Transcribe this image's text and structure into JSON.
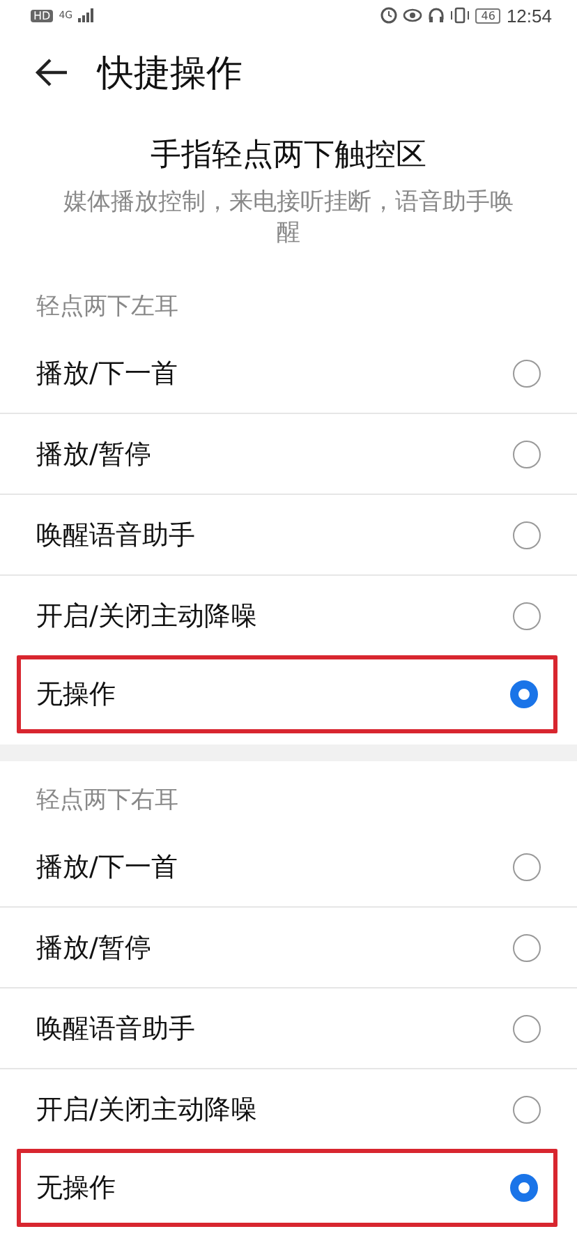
{
  "status_bar": {
    "network_badge": "HD",
    "network_type": "4G",
    "battery": "46",
    "time": "12:54"
  },
  "header": {
    "title": "快捷操作"
  },
  "intro": {
    "title": "手指轻点两下触控区",
    "description": "媒体播放控制，来电接听挂断，语音助手唤醒"
  },
  "sections": [
    {
      "label": "轻点两下左耳",
      "options": [
        {
          "label": "播放/下一首",
          "selected": false,
          "highlighted": false
        },
        {
          "label": "播放/暂停",
          "selected": false,
          "highlighted": false
        },
        {
          "label": "唤醒语音助手",
          "selected": false,
          "highlighted": false
        },
        {
          "label": "开启/关闭主动降噪",
          "selected": false,
          "highlighted": false
        },
        {
          "label": "无操作",
          "selected": true,
          "highlighted": true
        }
      ]
    },
    {
      "label": "轻点两下右耳",
      "options": [
        {
          "label": "播放/下一首",
          "selected": false,
          "highlighted": false
        },
        {
          "label": "播放/暂停",
          "selected": false,
          "highlighted": false
        },
        {
          "label": "唤醒语音助手",
          "selected": false,
          "highlighted": false
        },
        {
          "label": "开启/关闭主动降噪",
          "selected": false,
          "highlighted": false
        },
        {
          "label": "无操作",
          "selected": true,
          "highlighted": true
        }
      ]
    }
  ]
}
